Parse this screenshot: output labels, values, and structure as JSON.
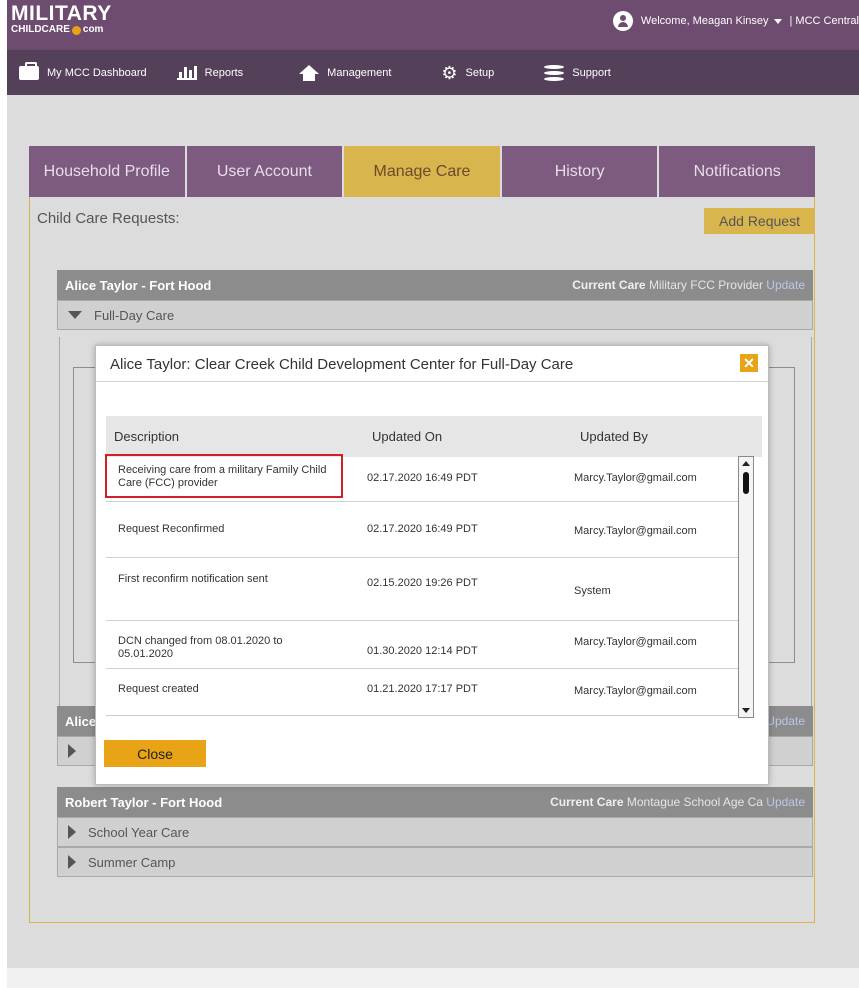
{
  "header": {
    "logo_main": "MILITARY",
    "logo_sub_left": "CHILDCARE",
    "logo_sub_right": "com",
    "welcome": "Welcome, Meagan Kinsey",
    "central": "| MCC Central"
  },
  "nav": {
    "dashboard": "My MCC Dashboard",
    "reports": "Reports",
    "management": "Management",
    "setup": "Setup",
    "support": "Support"
  },
  "tabs": [
    "Household Profile",
    "User Account",
    "Manage Care",
    "History",
    "Notifications"
  ],
  "active_tab": "Manage Care",
  "panel": {
    "title": "Child Care Requests:",
    "add_request": "Add Request"
  },
  "children": [
    {
      "name": "Alice Taylor - Fort Hood",
      "current_label": "Current Care",
      "current_value": "Military FCC Provider",
      "update": "Update",
      "care_types": [
        "Full-Day Care"
      ]
    },
    {
      "name": "Alice",
      "update": "Update"
    },
    {
      "name": "Robert Taylor  - Fort Hood",
      "current_label": "Current Care",
      "current_value": "Montague School Age Ca",
      "update": "Update",
      "care_types": [
        "School Year Care",
        "Summer Camp"
      ]
    }
  ],
  "modal": {
    "title": "Alice Taylor: Clear Creek Child Development Center for Full-Day Care",
    "close_x": "✕",
    "columns": [
      "Description",
      "Updated On",
      "Updated By"
    ],
    "rows": [
      {
        "description": "Receiving care from a military Family Child Care (FCC) provider",
        "updated_on": "02.17.2020 16:49 PDT",
        "updated_by": "Marcy.Taylor@gmail.com"
      },
      {
        "description": "Request Reconfirmed",
        "updated_on": "02.17.2020 16:49 PDT",
        "updated_by": "Marcy.Taylor@gmail.com"
      },
      {
        "description": "First reconfirm notification sent",
        "updated_on": "02.15.2020 19:26 PDT",
        "updated_by": "System"
      },
      {
        "description": "DCN changed from 08.01.2020 to 05.01.2020",
        "updated_on": "01.30.2020 12:14 PDT",
        "updated_by": "Marcy.Taylor@gmail.com"
      },
      {
        "description": "Request created",
        "updated_on": "01.21.2020 17:17 PDT",
        "updated_by": "Marcy.Taylor@gmail.com"
      }
    ],
    "close_button": "Close"
  },
  "colors": {
    "header_purple": "#6e4c6f",
    "nav_purple": "#55405a",
    "tab_purple": "#7d5a80",
    "tab_gold": "#d9b54d",
    "button_orange": "#e8a317",
    "highlight_red": "#d0202a"
  }
}
